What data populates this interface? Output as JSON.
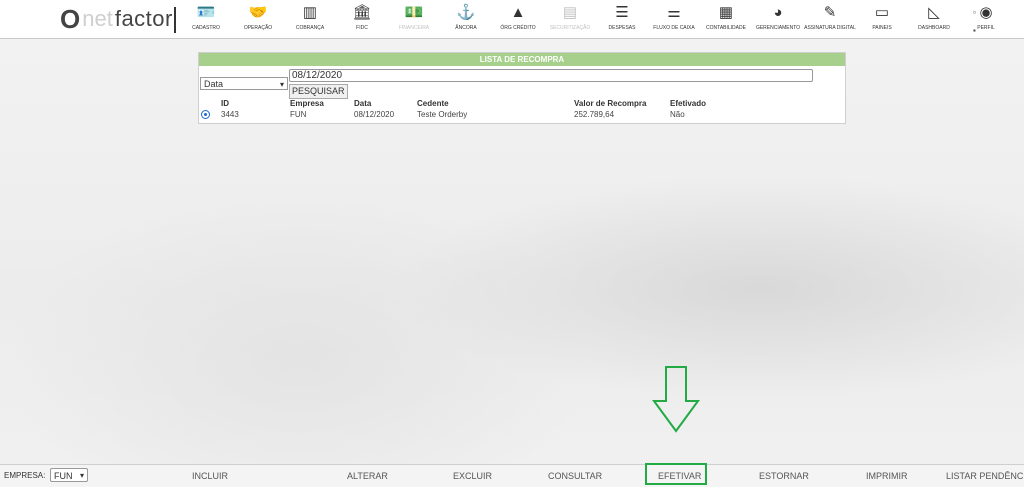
{
  "brand": {
    "o": "O",
    "net": "net",
    "factor": "factor"
  },
  "menu": [
    {
      "label": "CADASTRO",
      "icon": "id-card-icon",
      "glyph": "🪪",
      "disabled": false
    },
    {
      "label": "OPERAÇÃO",
      "icon": "handshake-icon",
      "glyph": "🤝",
      "disabled": false
    },
    {
      "label": "COBRANÇA",
      "icon": "barcode-icon",
      "glyph": "▥",
      "disabled": false
    },
    {
      "label": "FIDC",
      "icon": "bank-icon",
      "glyph": "🏛",
      "disabled": false
    },
    {
      "label": "FINANCEIRA",
      "icon": "money-icon",
      "glyph": "💵",
      "disabled": true
    },
    {
      "label": "ÂNCORA",
      "icon": "anchor-icon",
      "glyph": "⚓",
      "disabled": false
    },
    {
      "label": "ÓRG CRÉDITO",
      "icon": "warning-icon",
      "glyph": "▲",
      "disabled": false
    },
    {
      "label": "SECURITIZAÇÃO",
      "icon": "document-icon",
      "glyph": "▤",
      "disabled": true
    },
    {
      "label": "DESPESAS",
      "icon": "list-icon",
      "glyph": "☰",
      "disabled": false
    },
    {
      "label": "FLUXO DE CAIXA",
      "icon": "sliders-icon",
      "glyph": "⚌",
      "disabled": false
    },
    {
      "label": "CONTABILIDADE",
      "icon": "calculator-icon",
      "glyph": "▦",
      "disabled": false
    },
    {
      "label": "GERENCIAMENTO",
      "icon": "pie-chart-icon",
      "glyph": "◕",
      "disabled": false
    },
    {
      "label": "ASSINATURA DIGITAL",
      "icon": "pen-icon",
      "glyph": "✎",
      "disabled": false
    },
    {
      "label": "PAINEIS",
      "icon": "monitor-icon",
      "glyph": "▭",
      "disabled": false
    },
    {
      "label": "DASHBOARD",
      "icon": "area-chart-icon",
      "glyph": "◺",
      "disabled": false
    },
    {
      "label": "PERFIL",
      "icon": "user-icon",
      "glyph": "◉",
      "disabled": false
    }
  ],
  "panel": {
    "title": "LISTA DE RECOMPRA",
    "filter_select": "Data",
    "date_value": "08/12/2020",
    "search_label": "PESQUISAR",
    "headers": [
      "ID",
      "Empresa",
      "Data",
      "Cedente",
      "Valor de Recompra",
      "Efetivado"
    ],
    "row": [
      "3443",
      "FUN",
      "08/12/2020",
      "Teste Orderby",
      "252.789,64",
      "Não"
    ]
  },
  "bottom": {
    "empresa_label": "EMPRESA:",
    "empresa_value": "FUN",
    "actions": [
      "INCLUIR",
      "ALTERAR",
      "EXCLUIR",
      "CONSULTAR",
      "EFETIVAR",
      "ESTORNAR",
      "IMPRIMIR",
      "LISTAR PENDÊNCIA"
    ]
  },
  "colors": {
    "header_green": "#a6d08b",
    "highlight_green": "#22aa44",
    "radio_blue": "#1a66d6"
  }
}
